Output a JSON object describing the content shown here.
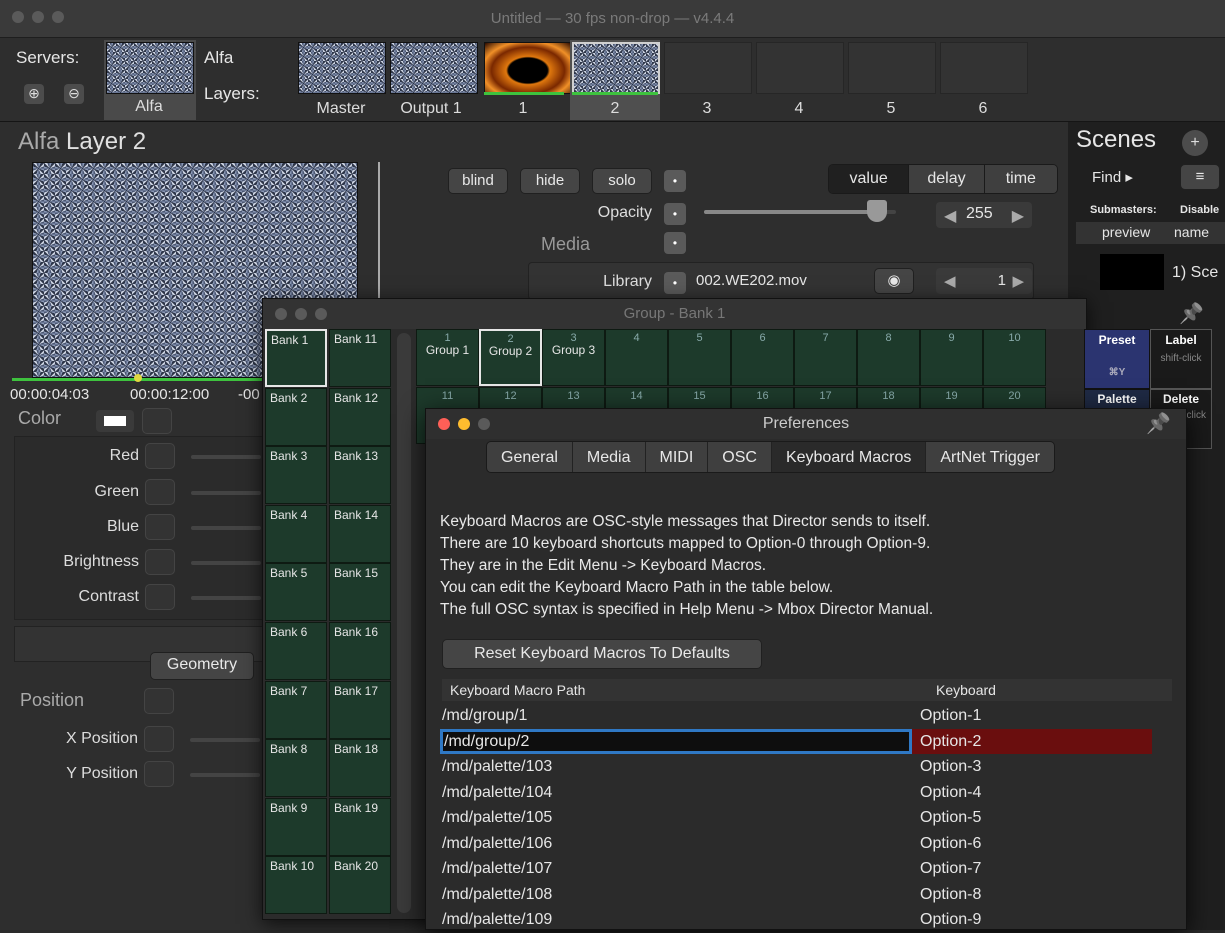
{
  "window": {
    "title": "Untitled  —  30 fps non-drop  —  v4.4.4"
  },
  "servers": {
    "label": "Servers:",
    "server_name": "Alfa",
    "thumb_label": "Alfa",
    "add_icon": "plus-circle-icon",
    "remove_icon": "minus-circle-icon"
  },
  "layers": {
    "label": "Layers:",
    "items": [
      "Master",
      "Output 1",
      "1",
      "2",
      "3",
      "4",
      "5",
      "6"
    ]
  },
  "layer_panel": {
    "server": "Alfa",
    "title": "Layer 2",
    "time_a": "00:00:04:03",
    "time_b": "00:00:12:00",
    "time_c": "-00",
    "color_label": "Color",
    "color_rows": [
      "Red",
      "Green",
      "Blue",
      "Brightness",
      "Contrast"
    ],
    "geometry_label": "Geometry",
    "position_label": "Position",
    "position_rows": [
      "X Position",
      "Y Position"
    ]
  },
  "controls": {
    "blind": "blind",
    "hide": "hide",
    "solo": "solo",
    "opacity": "Opacity",
    "media": "Media",
    "library": "Library",
    "file": "002.WE202.mov",
    "seg": [
      "value",
      "delay",
      "time"
    ],
    "opacity_value": "255",
    "file_value": "1",
    "opacity_level": 0.9
  },
  "scenes": {
    "title": "Scenes",
    "find": "Find",
    "submasters": "Submasters:",
    "disable": "Disable",
    "col_preview": "preview",
    "col_name": "name",
    "first_scene": "1) Sce"
  },
  "group_window": {
    "title": "Group - Bank 1",
    "banks_left": [
      "Bank 1",
      "Bank 2",
      "Bank 3",
      "Bank 4",
      "Bank 5",
      "Bank 6",
      "Bank 7",
      "Bank 8",
      "Bank 9",
      "Bank 10"
    ],
    "banks_right": [
      "Bank 11",
      "Bank 12",
      "Bank 13",
      "Bank 14",
      "Bank 15",
      "Bank 16",
      "Bank 17",
      "Bank 18",
      "Bank 19",
      "Bank 20"
    ],
    "row1": [
      {
        "n": "1",
        "t": "Group 1"
      },
      {
        "n": "2",
        "t": "Group 2"
      },
      {
        "n": "3",
        "t": "Group 3"
      },
      {
        "n": "4",
        "t": ""
      },
      {
        "n": "5",
        "t": ""
      },
      {
        "n": "6",
        "t": ""
      },
      {
        "n": "7",
        "t": ""
      },
      {
        "n": "8",
        "t": ""
      },
      {
        "n": "9",
        "t": ""
      },
      {
        "n": "10",
        "t": ""
      }
    ],
    "row2": [
      "11",
      "12",
      "13",
      "14",
      "15",
      "16",
      "17",
      "18",
      "19",
      "20"
    ],
    "side": {
      "preset": "Preset",
      "preset_key": "⌘Y",
      "label": "Label",
      "label_sub": "shift-click",
      "palette": "Palette",
      "delete": "Delete",
      "delete_sub": "option-click"
    }
  },
  "preferences": {
    "title": "Preferences",
    "tabs": [
      "General",
      "Media",
      "MIDI",
      "OSC",
      "Keyboard Macros",
      "ArtNet Trigger"
    ],
    "active_tab": "Keyboard Macros",
    "lines": [
      "Keyboard Macros are OSC-style messages that Director sends to itself.",
      "There are 10 keyboard shortcuts mapped to Option-0 through Option-9.",
      "They are in the Edit Menu -> Keyboard Macros.",
      "You can edit the Keyboard Macro Path in the table below.",
      "The full OSC syntax is specified in Help Menu -> Mbox Director Manual."
    ],
    "reset_button": "Reset Keyboard Macros To Defaults",
    "col_path": "Keyboard Macro Path",
    "col_key": "Keyboard",
    "rows": [
      {
        "path": "/md/group/1",
        "key": "Option-1"
      },
      {
        "path": "/md/group/2",
        "key": "Option-2"
      },
      {
        "path": "/md/palette/103",
        "key": "Option-3"
      },
      {
        "path": "/md/palette/104",
        "key": "Option-4"
      },
      {
        "path": "/md/palette/105",
        "key": "Option-5"
      },
      {
        "path": "/md/palette/106",
        "key": "Option-6"
      },
      {
        "path": "/md/palette/107",
        "key": "Option-7"
      },
      {
        "path": "/md/palette/108",
        "key": "Option-8"
      },
      {
        "path": "/md/palette/109",
        "key": "Option-9"
      }
    ],
    "pin_icon": "pin-icon"
  },
  "colors": {
    "accent_green": "#3ec23e",
    "selected_row": "#6a0e0e",
    "bank_green": "#1d3a2b",
    "focus_blue": "#2f78c4"
  }
}
